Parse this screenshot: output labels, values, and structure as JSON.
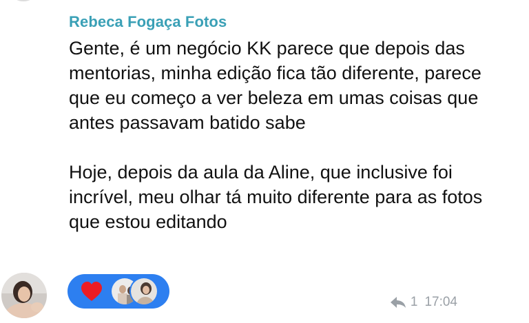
{
  "message": {
    "sender": "Rebeca Fogaça Fotos",
    "text": "Gente, é um negócio KK parece que depois das mentorias, minha edição fica tão diferente, parece que eu começo a ver beleza em umas coisas que antes passavam batido sabe\n\nHoje, depois da aula da Aline, que inclusive foi incrível, meu olhar tá muito diferente para as fotos que estou editando",
    "reply_count": "1",
    "time": "17:04"
  },
  "reaction": {
    "emoji": "heart-icon",
    "color": "#2d7ff0"
  },
  "colors": {
    "sender": "#3aa0b6",
    "meta": "#9aa0a6"
  }
}
